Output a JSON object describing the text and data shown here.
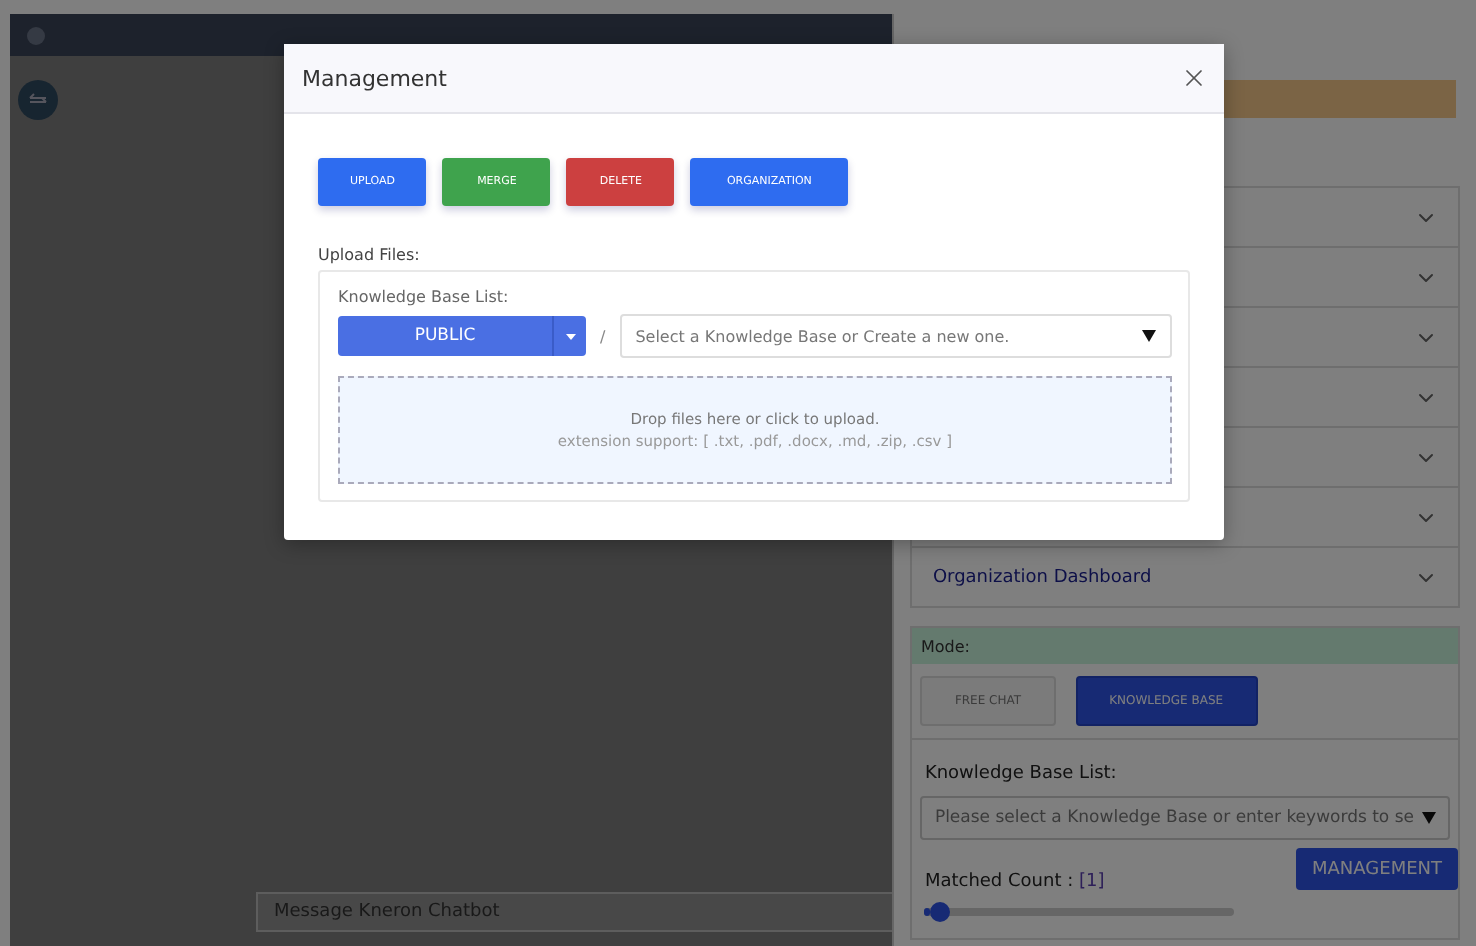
{
  "main": {
    "message_input": {
      "placeholder": "Message Kneron Chatbot"
    }
  },
  "settings_panel": {
    "sections": [
      {
        "expanded": false
      },
      {
        "expanded": false
      },
      {
        "expanded": false
      },
      {
        "expanded": false
      },
      {
        "expanded": false
      },
      {
        "expanded": false
      },
      {
        "label": "Organization Dashboard",
        "expanded": false
      }
    ],
    "mode": {
      "title": "Mode:",
      "options": [
        {
          "label": "FREE CHAT",
          "selected": false
        },
        {
          "label": "KNOWLEDGE BASE",
          "selected": true
        }
      ]
    },
    "knowledge_base": {
      "label": "Knowledge Base List:",
      "placeholder": "Please select a Knowledge Base or enter keywords to se"
    },
    "matched_count": {
      "label": "Matched Count :",
      "value": "[1]",
      "level": 0.02
    },
    "management_button": "MANAGEMENT"
  },
  "modal": {
    "title": "Management",
    "actions": [
      {
        "label": "UPLOAD",
        "kind": "upload"
      },
      {
        "label": "MERGE",
        "kind": "merge"
      },
      {
        "label": "DELETE",
        "kind": "delete"
      },
      {
        "label": "ORGANIZATION",
        "kind": "organization"
      }
    ],
    "upload_label": "Upload Files:",
    "kb_label": "Knowledge Base List:",
    "scope": "PUBLIC",
    "separator": "/",
    "kb_placeholder": "Select a Knowledge Base or Create a new one.",
    "dropzone": {
      "text": "Drop files here or click to upload.",
      "hint": "extension support: [ .txt, .pdf, .docx, .md, .zip, .csv ]"
    }
  }
}
